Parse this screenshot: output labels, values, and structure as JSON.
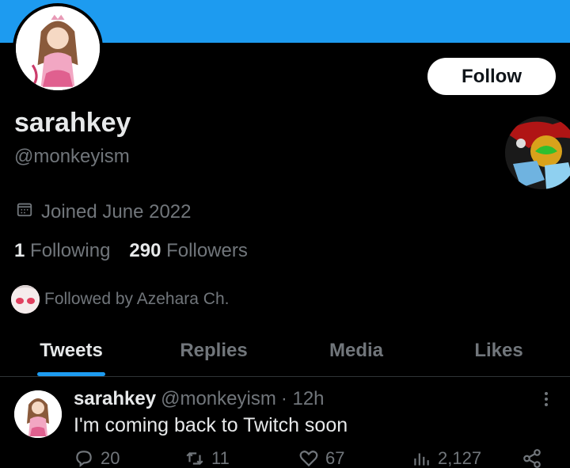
{
  "profile": {
    "display_name": "sarahkey",
    "handle": "@monkeyism",
    "joined": "Joined June 2022",
    "following_count": "1",
    "following_label": "Following",
    "followers_count": "290",
    "followers_label": "Followers",
    "followed_by": "Followed by Azehara Ch."
  },
  "follow_button": "Follow",
  "tabs": [
    {
      "label": "Tweets",
      "active": true
    },
    {
      "label": "Replies",
      "active": false
    },
    {
      "label": "Media",
      "active": false
    },
    {
      "label": "Likes",
      "active": false
    }
  ],
  "tweet": {
    "name": "sarahkey",
    "handle": "@monkeyism",
    "time": "· 12h",
    "text": "I'm coming back to Twitch soon",
    "replies": "20",
    "retweets": "11",
    "likes": "67",
    "views": "2,127"
  },
  "colors": {
    "banner": "#1d9bf0",
    "accent": "#1d9bf0",
    "background": "#000000",
    "muted_text": "#71767b"
  },
  "icons": [
    "calendar-icon",
    "reply-icon",
    "retweet-icon",
    "like-icon",
    "views-icon",
    "share-icon",
    "more-icon"
  ]
}
